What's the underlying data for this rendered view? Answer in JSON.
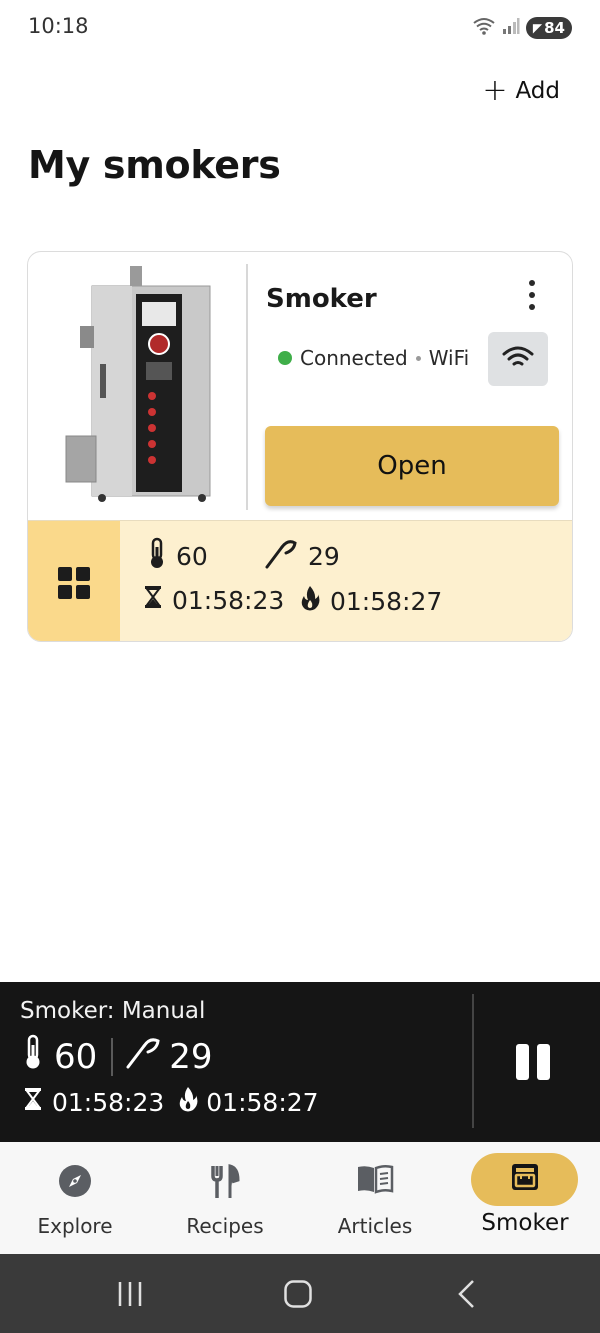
{
  "status_bar": {
    "time": "10:18",
    "battery": "84"
  },
  "header": {
    "add_label": "Add",
    "title": "My smokers"
  },
  "smoker_card": {
    "name": "Smoker",
    "connection_status": "Connected",
    "connection_type": "WiFi",
    "open_label": "Open",
    "temperature": "60",
    "probe_temperature": "29",
    "timer": "01:58:23",
    "smoke_timer": "01:58:27"
  },
  "now_playing": {
    "title": "Smoker: Manual",
    "temperature": "60",
    "probe_temperature": "29",
    "timer": "01:58:23",
    "smoke_timer": "01:58:27"
  },
  "bottom_nav": {
    "items": [
      {
        "label": "Explore",
        "icon": "compass-icon"
      },
      {
        "label": "Recipes",
        "icon": "fork-knife-icon"
      },
      {
        "label": "Articles",
        "icon": "book-icon"
      },
      {
        "label": "Smoker",
        "icon": "smoker-icon",
        "active": true
      }
    ]
  },
  "colors": {
    "accent": "#e6bc5a",
    "card_footer": "#fdf0cf",
    "grid_button": "#fad98b",
    "connected": "#3fae49",
    "now_playing_bg": "#151515"
  }
}
